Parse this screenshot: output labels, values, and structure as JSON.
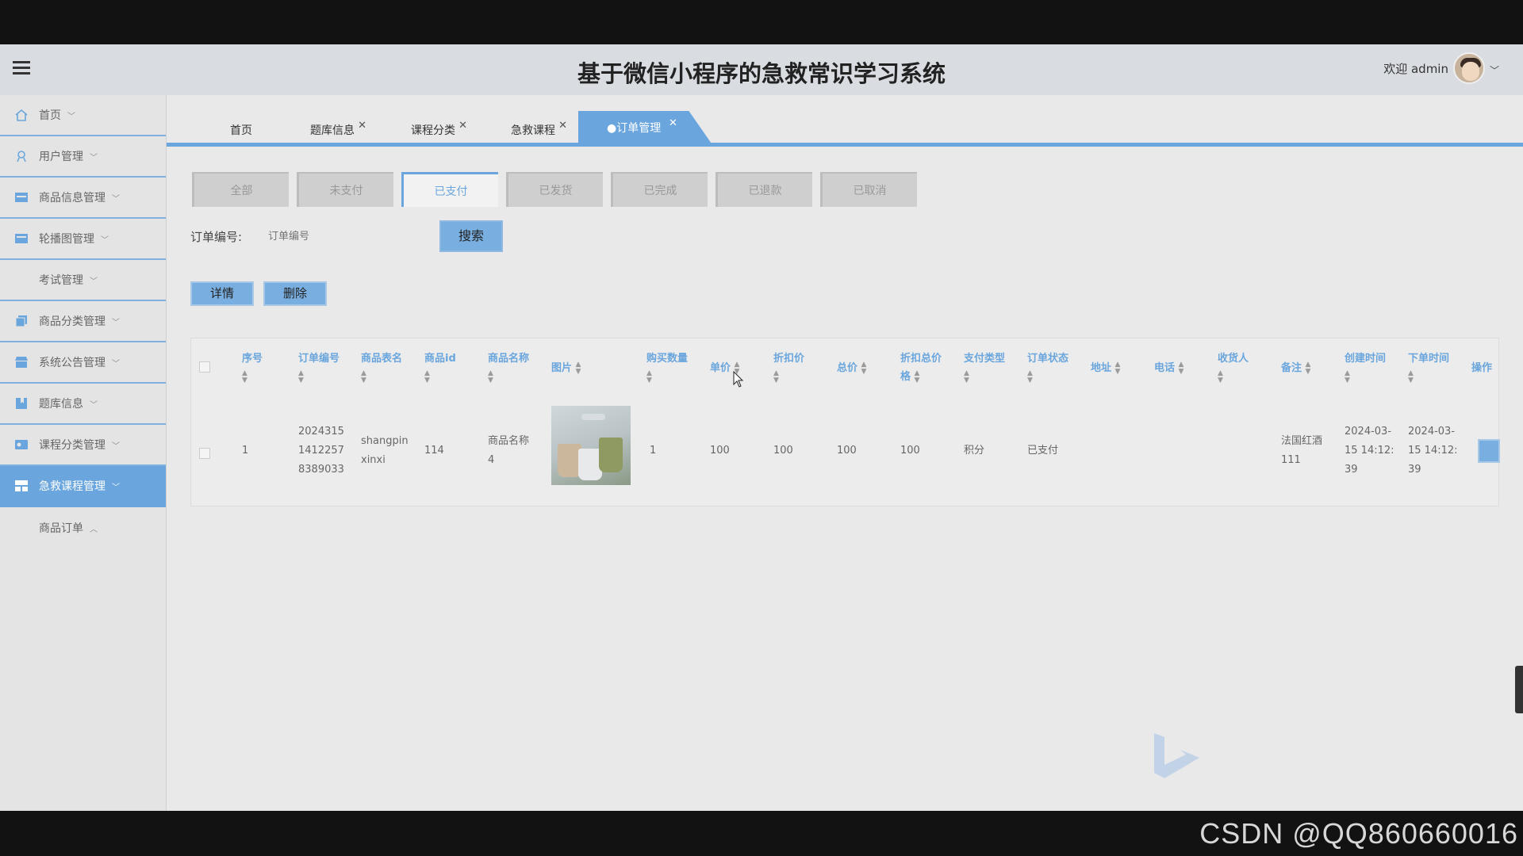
{
  "header": {
    "title": "基于微信小程序的急救常识学习系统",
    "welcome": "欢迎 admin"
  },
  "sidebar": {
    "items": [
      {
        "label": "首页",
        "icon": "home-icon"
      },
      {
        "label": "用户管理",
        "icon": "user-icon"
      },
      {
        "label": "商品信息管理",
        "icon": "list-icon"
      },
      {
        "label": "轮播图管理",
        "icon": "image-icon"
      },
      {
        "label": "考试管理",
        "icon": ""
      },
      {
        "label": "商品分类管理",
        "icon": "copy-icon"
      },
      {
        "label": "系统公告管理",
        "icon": "shop-icon"
      },
      {
        "label": "题库信息",
        "icon": "bookmark-icon"
      },
      {
        "label": "课程分类管理",
        "icon": "card-icon"
      },
      {
        "label": "急救课程管理",
        "icon": "grid-icon"
      }
    ],
    "sub_item": "商品订单"
  },
  "tabs": [
    {
      "label": "首页"
    },
    {
      "label": "题库信息"
    },
    {
      "label": "课程分类"
    },
    {
      "label": "急救课程"
    },
    {
      "label": "●订单管理"
    }
  ],
  "status_filters": [
    "全部",
    "未支付",
    "已支付",
    "已发货",
    "已完成",
    "已退款",
    "已取消"
  ],
  "search": {
    "label": "订单编号:",
    "placeholder": "订单编号",
    "button": "搜索"
  },
  "actions": {
    "detail": "详情",
    "delete": "删除"
  },
  "table": {
    "headers": {
      "index": "序号",
      "order_no": "订单编号",
      "goods_table": "商品表名",
      "goods_id": "商品id",
      "goods_name": "商品名称",
      "image": "图片",
      "qty": "购买数量",
      "unit_price": "单价",
      "discount_price": "折扣价",
      "total": "总价",
      "discount_total_1": "折扣总价",
      "discount_total_2": "格",
      "pay_type": "支付类型",
      "order_status": "订单状态",
      "address": "地址",
      "phone": "电话",
      "receiver": "收货人",
      "remark": "备注",
      "created": "创建时间",
      "order_time": "下单时间",
      "operation": "操作"
    },
    "row": {
      "index": "1",
      "order_no_1": "2024315",
      "order_no_2": "1412257",
      "order_no_3": "8389033",
      "goods_table_1": "shangpin",
      "goods_table_2": "xinxi",
      "goods_id": "114",
      "goods_name_1": "商品名称",
      "goods_name_2": "4",
      "qty": "1",
      "unit_price": "100",
      "discount_price": "100",
      "total": "100",
      "discount_total": "100",
      "pay_type": "积分",
      "order_status": "已支付",
      "remark_1": "法国红酒",
      "remark_2": "111",
      "created_1": "2024-03-",
      "created_2": "15 14:12:",
      "created_3": "39",
      "order_time_1": "2024-03-",
      "order_time_2": "15 14:12:",
      "order_time_3": "39"
    }
  },
  "watermark": "CSDN @QQ860660016",
  "colors": {
    "accent": "#6aa6dd",
    "header_bg": "#d9dde2"
  }
}
